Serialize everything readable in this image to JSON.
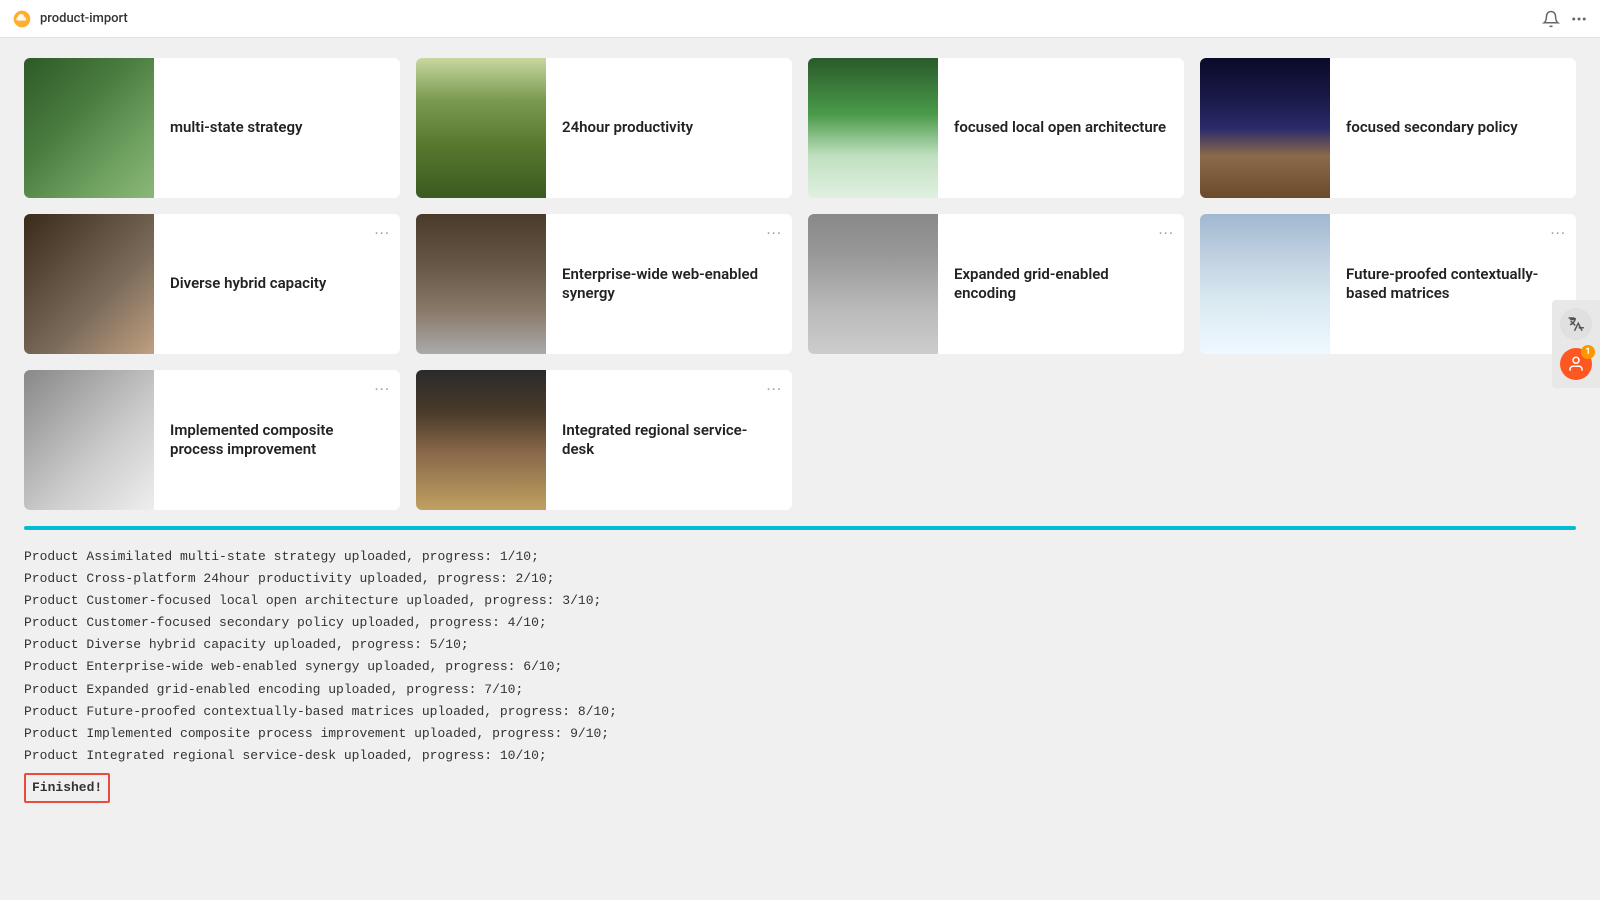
{
  "titlebar": {
    "title": "product-import",
    "logo_icon": "cloud-icon",
    "bell_icon": "bell-icon",
    "dots_icon": "more-icon"
  },
  "cards": [
    {
      "id": "card-1",
      "title": "multi-state strategy",
      "image_class": "img-forest",
      "has_menu": false
    },
    {
      "id": "card-2",
      "title": "24hour productivity",
      "image_class": "img-valley",
      "has_menu": false
    },
    {
      "id": "card-3",
      "title": "focused local open architecture",
      "image_class": "img-waterfall",
      "has_menu": false
    },
    {
      "id": "card-4",
      "title": "focused secondary policy",
      "image_class": "img-mountain-night",
      "has_menu": false
    },
    {
      "id": "card-5",
      "title": "Diverse hybrid capacity",
      "image_class": "img-cafe",
      "has_menu": true
    },
    {
      "id": "card-6",
      "title": "Enterprise-wide web-enabled synergy",
      "image_class": "img-building",
      "has_menu": true
    },
    {
      "id": "card-7",
      "title": "Expanded grid-enabled encoding",
      "image_class": "img-city-aerial",
      "has_menu": true
    },
    {
      "id": "card-8",
      "title": "Future-proofed contextually-based matrices",
      "image_class": "img-clouds",
      "has_menu": true
    },
    {
      "id": "card-9",
      "title": "Implemented composite process improvement",
      "image_class": "img-dome",
      "has_menu": true
    },
    {
      "id": "card-10",
      "title": "Integrated regional service-desk",
      "image_class": "img-volcano",
      "has_menu": true
    }
  ],
  "menu_dots": "···",
  "log": {
    "lines": [
      "Product Assimilated multi-state strategy uploaded, progress: 1/10;",
      "Product Cross-platform 24hour productivity uploaded, progress: 2/10;",
      "Product Customer-focused local open architecture uploaded, progress: 3/10;",
      "Product Customer-focused secondary policy uploaded, progress: 4/10;",
      "Product Diverse hybrid capacity uploaded, progress: 5/10;",
      "Product Enterprise-wide web-enabled synergy uploaded, progress: 6/10;",
      "Product Expanded grid-enabled encoding uploaded, progress: 7/10;",
      "Product Future-proofed contextually-based matrices uploaded, progress: 8/10;",
      "Product Implemented composite process improvement uploaded, progress: 9/10;",
      "Product Integrated regional service-desk uploaded, progress: 10/10;"
    ],
    "finished": "Finished!"
  },
  "right_sidebar": {
    "translate_icon": "translate-icon",
    "user_icon": "user-icon"
  }
}
